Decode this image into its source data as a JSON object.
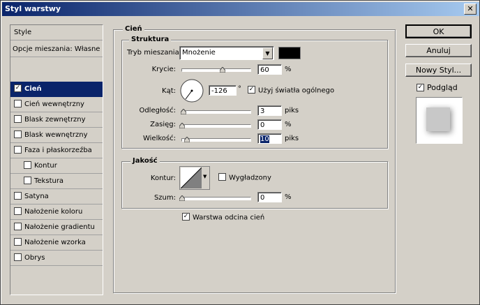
{
  "window": {
    "title": "Styl warstwy"
  },
  "sidebar": {
    "header": "Style",
    "blending": "Opcje mieszania: Własne",
    "items": [
      {
        "label": "Cień",
        "checked": true,
        "selected": true,
        "indent": false
      },
      {
        "label": "Cień wewnętrzny",
        "checked": false,
        "indent": false
      },
      {
        "label": "Blask zewnętrzny",
        "checked": false,
        "indent": false
      },
      {
        "label": "Blask wewnętrzny",
        "checked": false,
        "indent": false
      },
      {
        "label": "Faza i płaskorzeźba",
        "checked": false,
        "indent": false
      },
      {
        "label": "Kontur",
        "checked": false,
        "indent": true
      },
      {
        "label": "Tekstura",
        "checked": false,
        "indent": true
      },
      {
        "label": "Satyna",
        "checked": false,
        "indent": false
      },
      {
        "label": "Nałożenie koloru",
        "checked": false,
        "indent": false
      },
      {
        "label": "Nałożenie gradientu",
        "checked": false,
        "indent": false
      },
      {
        "label": "Nałożenie wzorka",
        "checked": false,
        "indent": false
      },
      {
        "label": "Obrys",
        "checked": false,
        "indent": false
      }
    ]
  },
  "panel": {
    "title": "Cień",
    "structure": {
      "title": "Struktura",
      "blend_label": "Tryb mieszania:",
      "blend_value": "Mnożenie",
      "blend_color": "#000000",
      "opacity_label": "Krycie:",
      "opacity_value": "60",
      "opacity_level": 60,
      "opacity_unit": "%",
      "angle_label": "Kąt:",
      "angle_value": "-126",
      "angle_unit": "°",
      "global_light_label": "Użyj światła ogólnego",
      "global_light_checked": true,
      "distance_label": "Odległość:",
      "distance_value": "3",
      "distance_unit": "piks",
      "spread_label": "Zasięg:",
      "spread_value": "0",
      "spread_unit": "%",
      "size_label": "Wielkość:",
      "size_value": "10",
      "size_unit": "piks"
    },
    "quality": {
      "title": "Jakość",
      "contour_label": "Kontur:",
      "antialias_label": "Wygładzony",
      "antialias_checked": false,
      "noise_label": "Szum:",
      "noise_value": "0",
      "noise_unit": "%"
    },
    "knockout_label": "Warstwa odcina cień",
    "knockout_checked": true
  },
  "buttons": {
    "ok": "OK",
    "cancel": "Anuluj",
    "new_style": "Nowy Styl...",
    "preview_label": "Podgląd",
    "preview_checked": true
  }
}
